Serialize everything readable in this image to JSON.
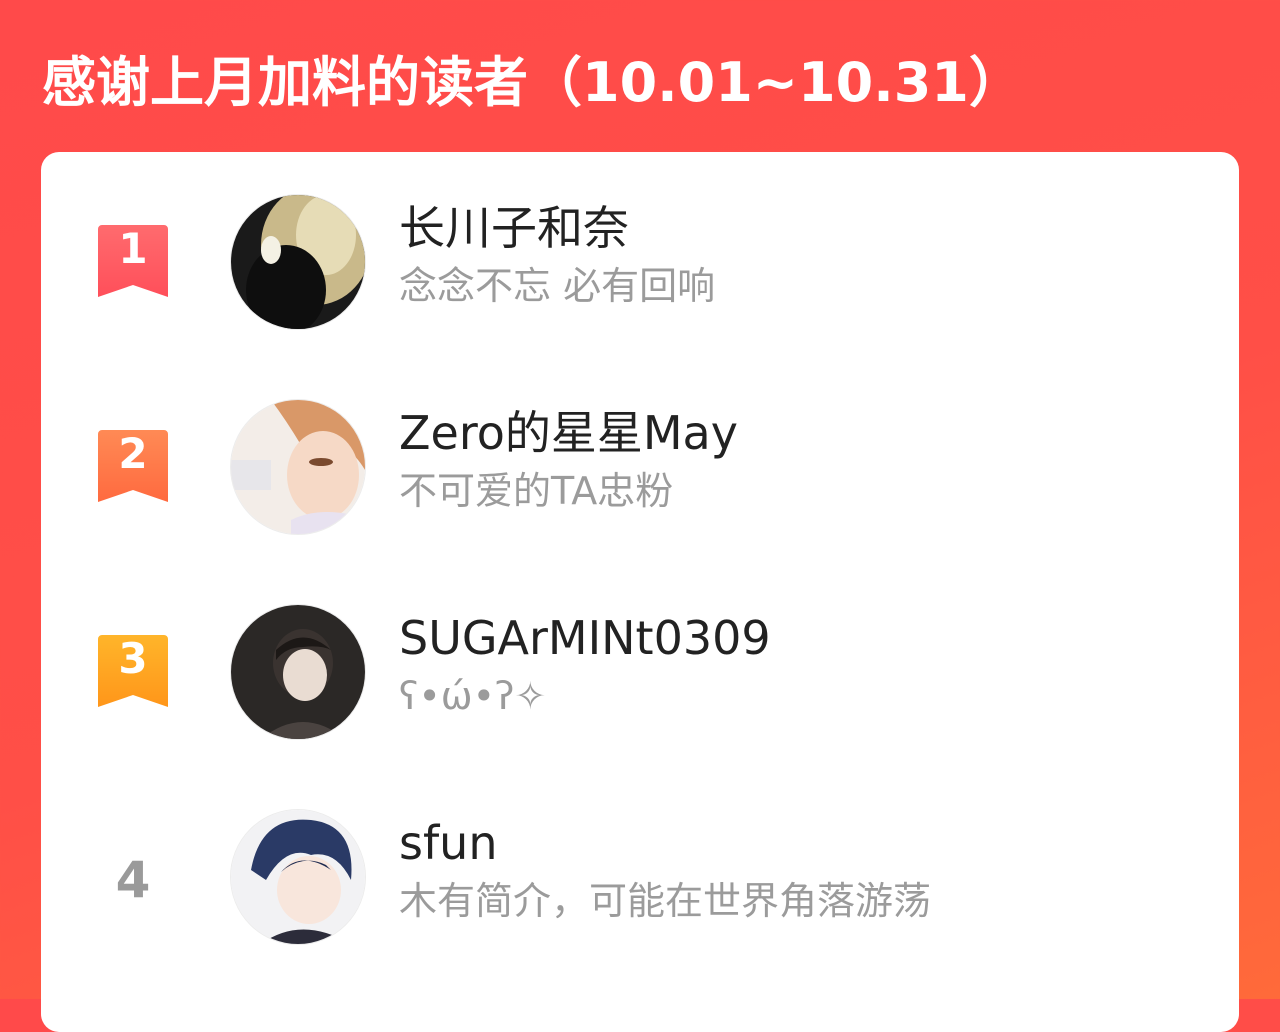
{
  "header": {
    "title": "感谢上月加料的读者（10.01~10.31）"
  },
  "colors": {
    "background": "#ff4a4a",
    "rank1": "#ff5a5f",
    "rank2": "#ff7a45",
    "rank3": "#ffa51f",
    "name": "#222222",
    "bio": "#9b9b9b"
  },
  "readers": [
    {
      "rank": "1",
      "name": "长川子和奈",
      "bio": "念念不忘 必有回响",
      "avatar_icon": "avatar-dark-portrait-icon"
    },
    {
      "rank": "2",
      "name": "Zero的星星May",
      "bio": "不可爱的TA忠粉",
      "avatar_icon": "avatar-anime-boy-icon"
    },
    {
      "rank": "3",
      "name": "SUGArMINt0309",
      "bio": "ʕ•ώ•ʔ✧",
      "avatar_icon": "avatar-photo-boy-icon"
    },
    {
      "rank": "4",
      "name": "sfun",
      "bio": "木有简介，可能在世界角落游荡",
      "avatar_icon": "avatar-anime-blue-hair-icon"
    }
  ]
}
